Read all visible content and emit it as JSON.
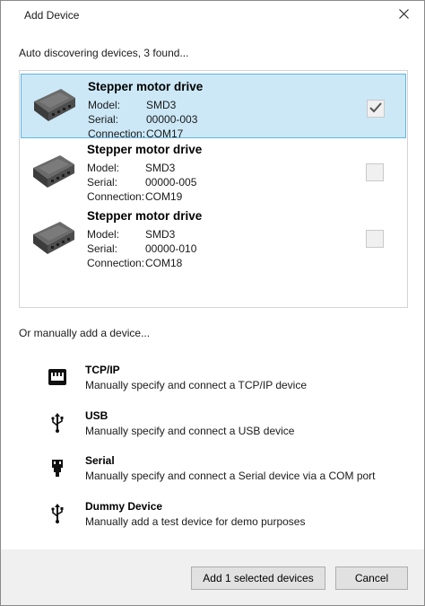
{
  "window": {
    "title": "Add Device",
    "close_glyph": "✕"
  },
  "discovery": {
    "status": "Auto discovering devices, 3 found..."
  },
  "labels": {
    "model": "Model:",
    "serial": "Serial:",
    "connection": "Connection:"
  },
  "devices": [
    {
      "name": "Stepper motor drive",
      "model": "SMD3",
      "serial": "00000-003",
      "connection": "COM17",
      "checked": true
    },
    {
      "name": "Stepper motor drive",
      "model": "SMD3",
      "serial": "00000-005",
      "connection": "COM19",
      "checked": false
    },
    {
      "name": "Stepper motor drive",
      "model": "SMD3",
      "serial": "00000-010",
      "connection": "COM18",
      "checked": false
    }
  ],
  "manual": {
    "header": "Or manually add a device...",
    "options": [
      {
        "icon": "ethernet-icon",
        "title": "TCP/IP",
        "description": "Manually specify and connect a TCP/IP device"
      },
      {
        "icon": "usb-icon",
        "title": "USB",
        "description": "Manually specify and connect a USB device"
      },
      {
        "icon": "serial-port-icon",
        "title": "Serial",
        "description": "Manually specify and connect a Serial device via a COM port"
      },
      {
        "icon": "usb-icon",
        "title": "Dummy Device",
        "description": "Manually add a test device for demo purposes"
      }
    ]
  },
  "footer": {
    "add_label": "Add 1 selected devices",
    "cancel_label": "Cancel"
  },
  "colors": {
    "selected_bg": "#cce8f7",
    "selected_border": "#5eb6e4",
    "footer_bg": "#f0f0f0"
  }
}
